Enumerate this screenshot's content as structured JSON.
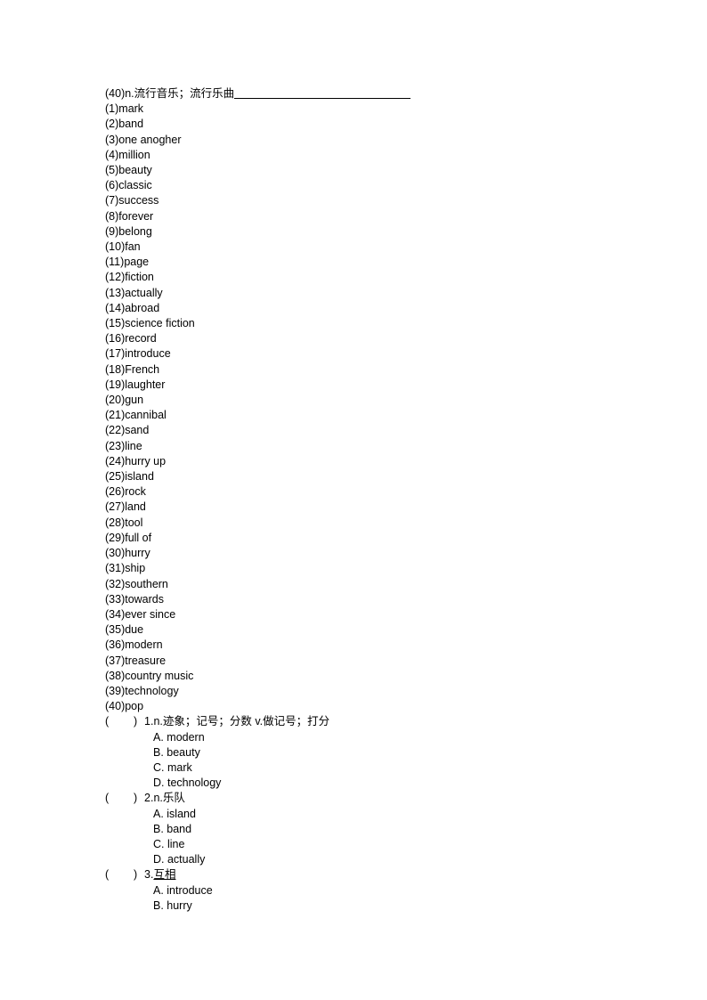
{
  "document": {
    "type": "vocabulary-worksheet",
    "background_color": "#ffffff",
    "text_color": "#000000",
    "header_line": {
      "number": "(40)",
      "text": "n.流行音乐；流行乐曲",
      "has_blank": true
    },
    "word_list": [
      {
        "number": "(1)",
        "word": "mark"
      },
      {
        "number": "(2)",
        "word": "band"
      },
      {
        "number": "(3)",
        "word": "one anogher"
      },
      {
        "number": "(4)",
        "word": "million"
      },
      {
        "number": "(5)",
        "word": "beauty"
      },
      {
        "number": "(6)",
        "word": "classic"
      },
      {
        "number": "(7)",
        "word": "success"
      },
      {
        "number": "(8)",
        "word": "forever"
      },
      {
        "number": "(9)",
        "word": "belong"
      },
      {
        "number": "(10)",
        "word": "fan"
      },
      {
        "number": "(11)",
        "word": "page"
      },
      {
        "number": "(12)",
        "word": "fiction"
      },
      {
        "number": "(13)",
        "word": "actually"
      },
      {
        "number": "(14)",
        "word": "abroad"
      },
      {
        "number": "(15)",
        "word": "science fiction"
      },
      {
        "number": "(16)",
        "word": "record"
      },
      {
        "number": "(17)",
        "word": "introduce"
      },
      {
        "number": "(18)",
        "word": "French"
      },
      {
        "number": "(19)",
        "word": "laughter"
      },
      {
        "number": "(20)",
        "word": "gun"
      },
      {
        "number": "(21)",
        "word": "cannibal"
      },
      {
        "number": "(22)",
        "word": "sand"
      },
      {
        "number": "(23)",
        "word": "line"
      },
      {
        "number": "(24)",
        "word": "hurry up"
      },
      {
        "number": "(25)",
        "word": "island"
      },
      {
        "number": "(26)",
        "word": "rock"
      },
      {
        "number": "(27)",
        "word": "land"
      },
      {
        "number": "(28)",
        "word": "tool"
      },
      {
        "number": "(29)",
        "word": "full of"
      },
      {
        "number": "(30)",
        "word": "hurry"
      },
      {
        "number": "(31)",
        "word": "ship"
      },
      {
        "number": "(32)",
        "word": "southern"
      },
      {
        "number": "(33)",
        "word": "towards"
      },
      {
        "number": "(34)",
        "word": "ever since"
      },
      {
        "number": "(35)",
        "word": "due"
      },
      {
        "number": "(36)",
        "word": "modern"
      },
      {
        "number": "(37)",
        "word": "treasure"
      },
      {
        "number": "(38)",
        "word": "country music"
      },
      {
        "number": "(39)",
        "word": "technology"
      },
      {
        "number": "(40)",
        "word": "pop"
      }
    ],
    "questions": [
      {
        "bracket": "(        )",
        "number": "1.",
        "prompt": "n.迹象；记号；分数 v.做记号；打分",
        "prompt_underlined": false,
        "options": [
          "A. modern",
          "B. beauty",
          "C. mark",
          "D. technology"
        ]
      },
      {
        "bracket": "(        )",
        "number": "2.",
        "prompt": "n.乐队",
        "prompt_underlined": false,
        "options": [
          "A. island",
          "B. band",
          "C. line",
          "D. actually"
        ]
      },
      {
        "bracket": "(        )",
        "number": "3.",
        "prompt": "互相",
        "prompt_underlined": true,
        "options": [
          "A. introduce",
          "B. hurry"
        ]
      }
    ]
  }
}
